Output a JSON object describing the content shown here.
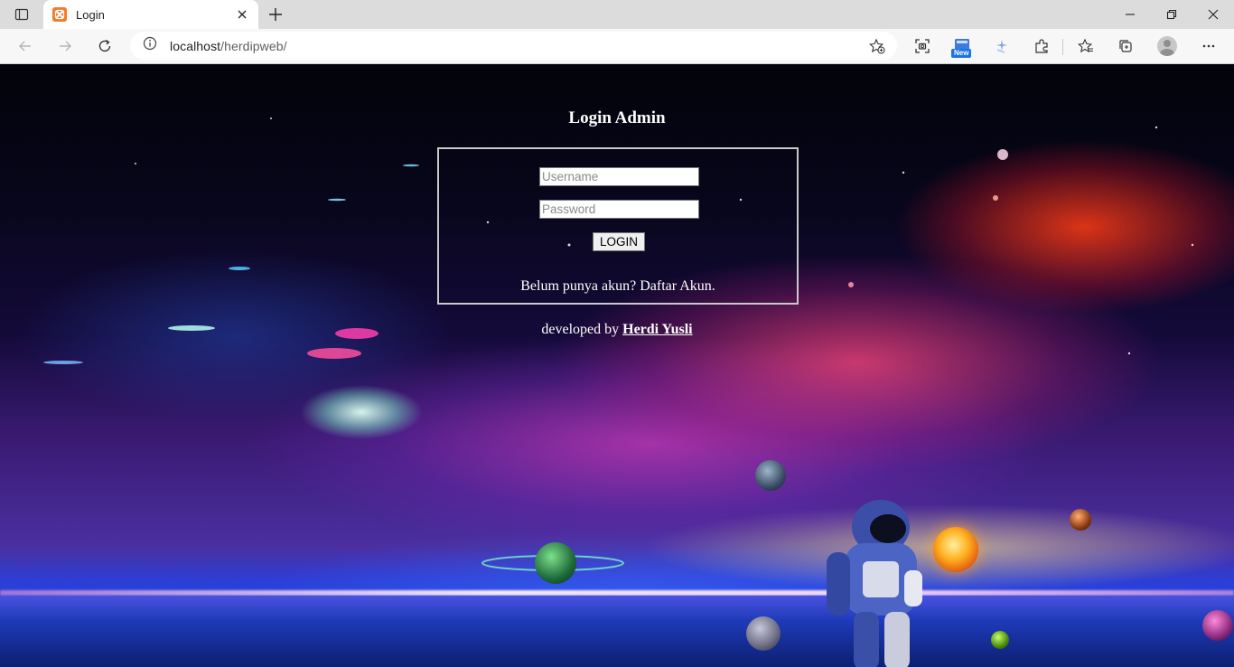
{
  "browser": {
    "tab": {
      "title": "Login"
    },
    "address": {
      "host": "localhost",
      "path": "/herdipweb/"
    },
    "badges": {
      "new": "New"
    }
  },
  "page": {
    "title": "Login Admin",
    "form": {
      "username_placeholder": "Username",
      "password_placeholder": "Password",
      "login_label": "LOGIN"
    },
    "register": {
      "text": "Belum punya akun? Daftar Akun."
    },
    "footer": {
      "prefix": "developed by ",
      "author": "Herdi Yusli"
    }
  },
  "colors": {
    "text": "#ffffff",
    "box_border": "#c9c9c9",
    "favicon": "#f27b2c",
    "new_badge": "#1a73e8"
  },
  "icons": [
    "tab-actions-icon",
    "xampp-favicon-icon",
    "close-icon",
    "plus-icon",
    "minimize-icon",
    "restore-icon",
    "window-close-icon",
    "back-arrow-icon",
    "forward-arrow-icon",
    "refresh-icon",
    "info-icon",
    "add-favorite-icon",
    "screenshot-icon",
    "new-feature-icon",
    "sparkle-icon",
    "extensions-icon",
    "favorites-icon",
    "collections-icon",
    "profile-icon",
    "more-icon"
  ]
}
